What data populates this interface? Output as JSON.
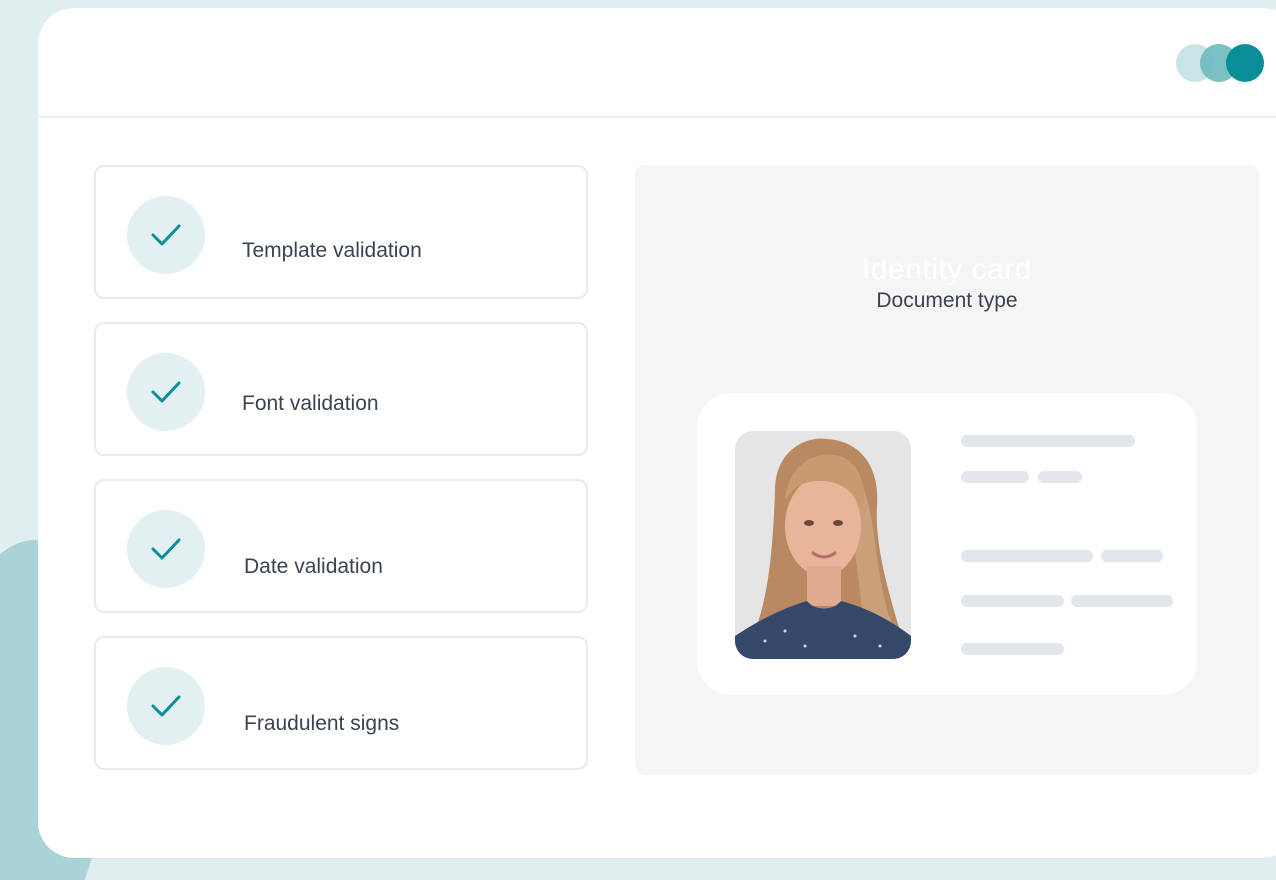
{
  "header": {
    "window_dots": [
      "light-teal",
      "mid-teal",
      "dark-teal"
    ]
  },
  "checks": [
    {
      "label": "Template validation",
      "icon": "check-icon"
    },
    {
      "label": "Font validation",
      "icon": "check-icon"
    },
    {
      "label": "Date validation",
      "icon": "check-icon"
    },
    {
      "label": "Fraudulent signs",
      "icon": "check-icon"
    }
  ],
  "document": {
    "title": "Identity card",
    "subtitle": "Document type",
    "photo": "portrait-photo",
    "placeholder_lines": "skeleton-text"
  },
  "colors": {
    "accent": "#0a8e98",
    "check_bg": "#e3f0f1",
    "panel_bg": "#f5f5f6",
    "text": "#3a4350",
    "skeleton": "#e2e7ee"
  }
}
